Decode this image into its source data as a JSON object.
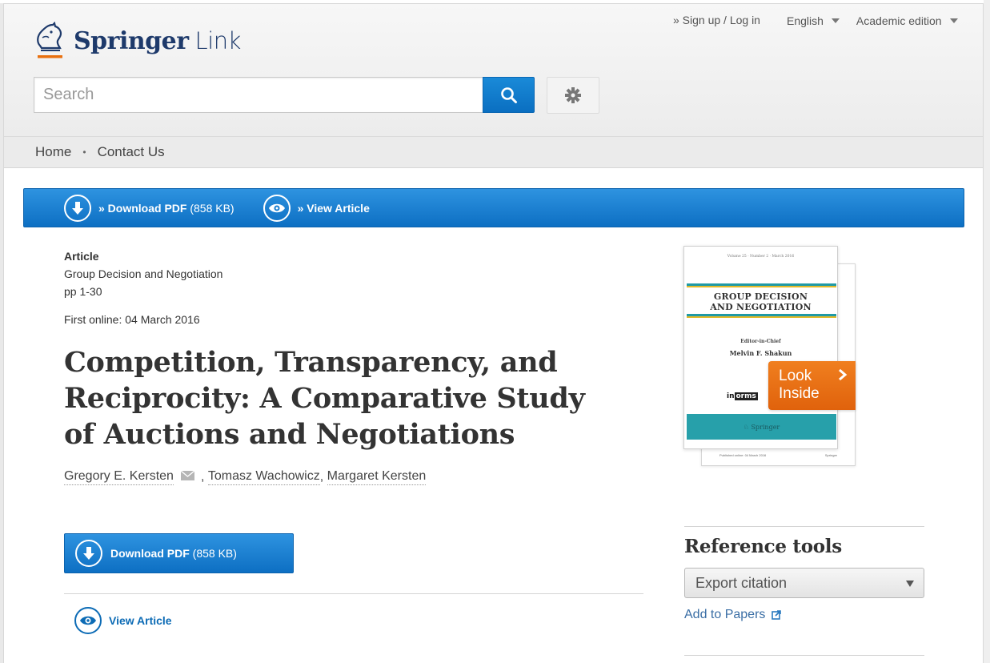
{
  "header": {
    "brand_primary": "Springer",
    "brand_secondary": "Link",
    "signup_label": "» Sign up / Log in",
    "language_label": "English",
    "edition_label": "Academic edition",
    "search_placeholder": "Search",
    "search_value": ""
  },
  "breadcrumb": {
    "items": [
      {
        "label": "Home"
      },
      {
        "label": "Contact Us"
      }
    ],
    "separator": "•"
  },
  "action_bar": {
    "download_label": "» Download PDF",
    "download_size": "(858 KB)",
    "view_label": "» View Article"
  },
  "article": {
    "type": "Article",
    "journal": "Group Decision and Negotiation",
    "pages": "pp 1-30",
    "first_online": "First online: 04 March 2016",
    "title": "Competition, Transparency, and Reciprocity: A Comparative Study of Auctions and Negotiations",
    "authors": [
      {
        "name": "Gregory E. Kersten",
        "has_email": true
      },
      {
        "name": "Tomasz Wachowicz",
        "has_email": false
      },
      {
        "name": "Margaret Kersten",
        "has_email": false
      }
    ],
    "download_button_label": "Download PDF",
    "download_button_size": "(858 KB)",
    "view_article_label": "View Article"
  },
  "cover": {
    "volume_line": "Volume 25 · Number 2 · March 2016",
    "journal_title_line1": "GROUP DECISION",
    "journal_title_line2": "AND NEGOTIATION",
    "editor_heading": "Editor-in-Chief",
    "editor_name": "Melvin F. Shakun",
    "publisher_logo": "informs",
    "footer_brand": "Springer",
    "back_published": "Published online: 04 March 2016",
    "back_brand": "Springer",
    "look_inside_line1": "Look",
    "look_inside_line2": "Inside"
  },
  "reference_tools": {
    "title": "Reference tools",
    "export_select_value": "Export citation",
    "add_to_papers_label": "Add to Papers"
  },
  "colors": {
    "primary_blue": "#0d6fc3",
    "link_blue": "#0c6bb5",
    "look_inside_orange": "#e8700f",
    "brand_navy": "#1e3a6b",
    "brand_orange": "#e8700f"
  }
}
